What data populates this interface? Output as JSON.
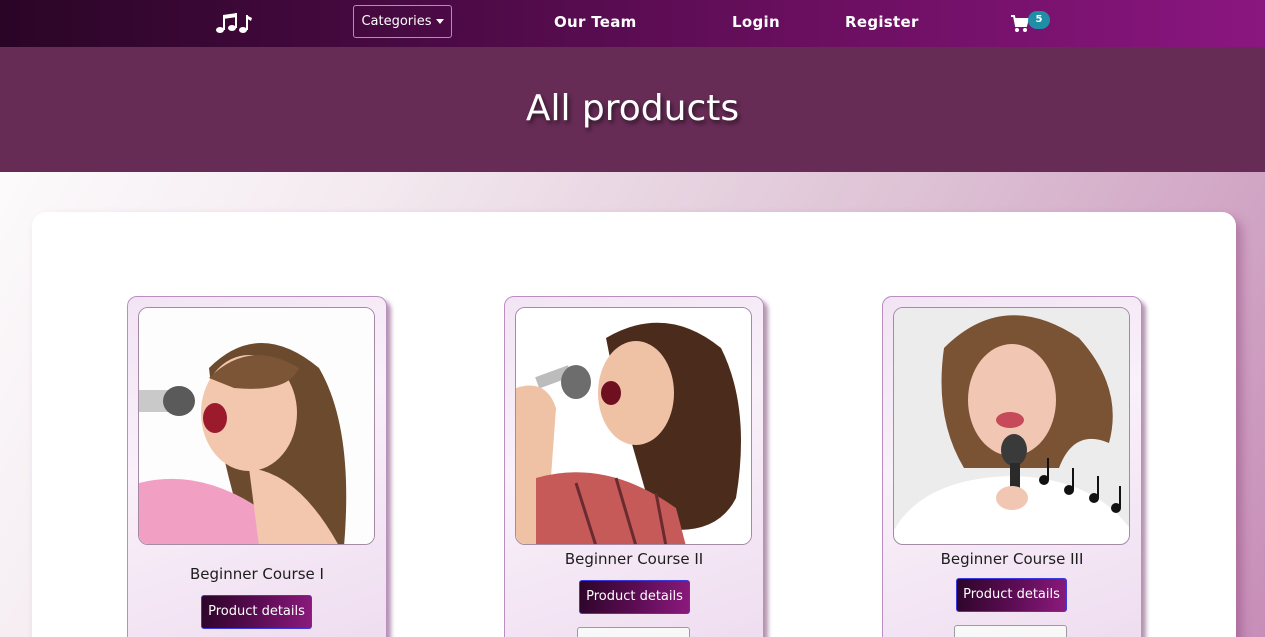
{
  "nav": {
    "brand_icon": "music-notes-icon",
    "categories_label": "Categories",
    "links": [
      "Our Team",
      "Login",
      "Register"
    ],
    "cart_icon": "shopping-cart-icon",
    "cart_count": "5"
  },
  "hero": {
    "title": "All products"
  },
  "products": [
    {
      "title": "Beginner Course I",
      "button": "Product details"
    },
    {
      "title": "Beginner Course II",
      "button": "Product details"
    },
    {
      "title": "Beginner Course III",
      "button": "Product details"
    }
  ],
  "colors": {
    "nav_start": "#2a0526",
    "nav_end": "#8a1680",
    "hero_bg": "#662c55",
    "badge": "#1f8fa8",
    "button_border": "#3a3ae0"
  }
}
